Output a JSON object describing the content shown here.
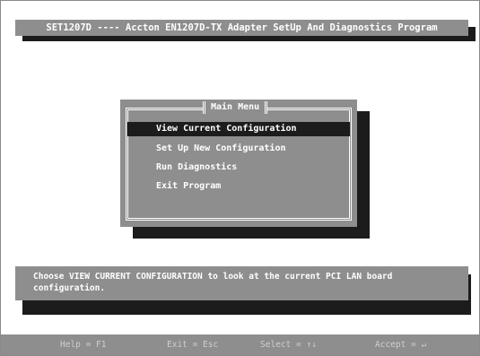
{
  "title": "SET1207D ---- Accton EN1207D-TX Adapter SetUp And Diagnostics Program",
  "menu": {
    "title": "Main Menu",
    "items": [
      {
        "label": "View Current Configuration",
        "selected": true
      },
      {
        "label": "Set Up New Configuration",
        "selected": false
      },
      {
        "label": "Run Diagnostics",
        "selected": false
      },
      {
        "label": "Exit Program",
        "selected": false
      }
    ]
  },
  "description": "Choose VIEW CURRENT CONFIGURATION to look at the current PCI LAN board configuration.",
  "keys": {
    "help": "Help = F1",
    "exit": "Exit = Esc",
    "select": "Select = ↑↓",
    "accept": "Accept = ↵"
  }
}
